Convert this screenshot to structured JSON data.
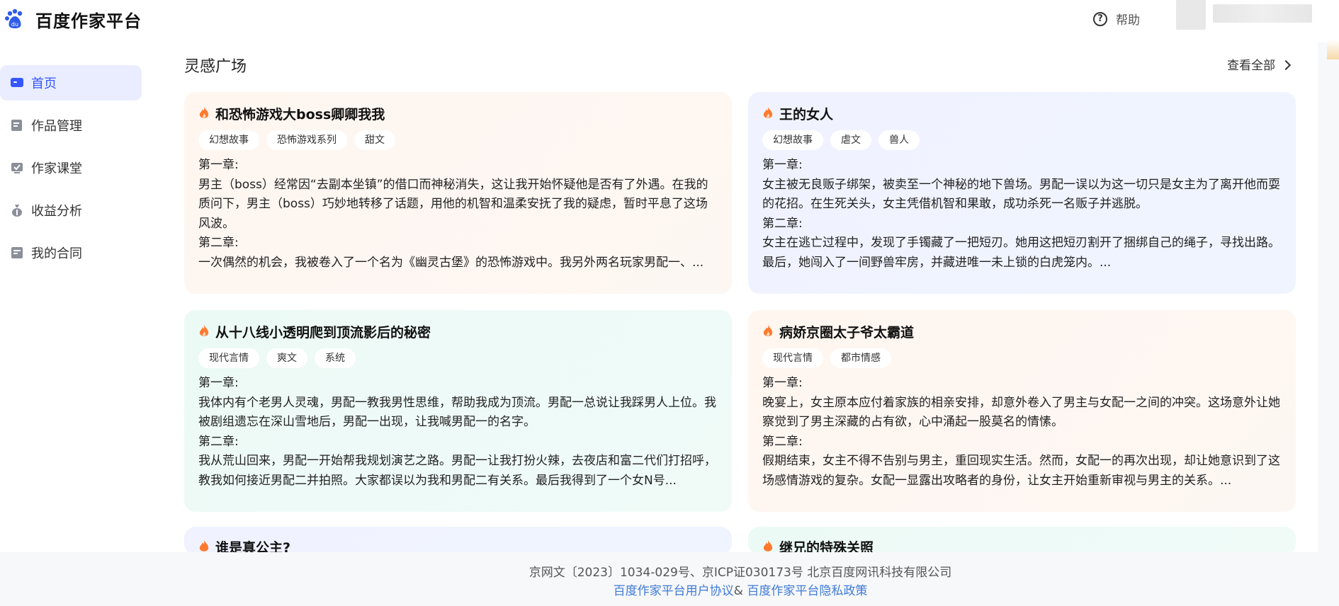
{
  "header": {
    "brand": "百度作家平台",
    "help_label": "帮助",
    "help_icon": "question-circle-icon"
  },
  "sidebar": {
    "items": [
      {
        "label": "首页",
        "icon": "home-icon",
        "active": true
      },
      {
        "label": "作品管理",
        "icon": "book-icon"
      },
      {
        "label": "作家课堂",
        "icon": "classroom-icon"
      },
      {
        "label": "收益分析",
        "icon": "money-bag-icon"
      },
      {
        "label": "我的合同",
        "icon": "contract-icon"
      }
    ]
  },
  "main": {
    "section_title": "灵感广场",
    "view_all": "查看全部",
    "cards": [
      {
        "title": "和恐怖游戏大boss卿卿我我",
        "tags": [
          "幻想故事",
          "恐怖游戏系列",
          "甜文"
        ],
        "ch1_label": "第一章:",
        "ch1_text": "男主（boss）经常因“去副本坐镇”的借口而神秘消失，这让我开始怀疑他是否有了外遇。在我的质问下，男主（boss）巧妙地转移了话题，用他的机智和温柔安抚了我的疑虑，暂时平息了这场风波。",
        "ch2_label": "第二章:",
        "ch2_text": "一次偶然的机会，我被卷入了一个名为《幽灵古堡》的恐怖游戏中。我另外两名玩家男配一、..."
      },
      {
        "title": "王的女人",
        "tags": [
          "幻想故事",
          "虐文",
          "兽人"
        ],
        "ch1_label": "第一章:",
        "ch1_text": "女主被无良贩子绑架，被卖至一个神秘的地下兽场。男配一误以为这一切只是女主为了离开他而耍的花招。在生死关头，女主凭借机智和果敢，成功杀死一名贩子并逃脱。",
        "ch2_label": "第二章:",
        "ch2_text": "女主在逃亡过程中，发现了手镯藏了一把短刃。她用这把短刃割开了捆绑自己的绳子，寻找出路。最后，她闯入了一间野兽牢房，并藏进唯一未上锁的白虎笼内。..."
      },
      {
        "title": "从十八线小透明爬到顶流影后的秘密",
        "tags": [
          "现代言情",
          "爽文",
          "系统"
        ],
        "ch1_label": "第一章:",
        "ch1_text": "我体内有个老男人灵魂，男配一教我男性思维，帮助我成为顶流。男配一总说让我踩男人上位。我被剧组遗忘在深山雪地后，男配一出现，让我喊男配一的名字。",
        "ch2_label": "第二章:",
        "ch2_text": "我从荒山回来，男配一开始帮我规划演艺之路。男配一让我打扮火辣，去夜店和富二代们打招呼，教我如何接近男配二并拍照。大家都误以为我和男配二有关系。最后我得到了一个女N号..."
      },
      {
        "title": "病娇京圈太子爷太霸道",
        "tags": [
          "现代言情",
          "都市情感"
        ],
        "ch1_label": "第一章:",
        "ch1_text": "晚宴上，女主原本应付着家族的相亲安排，却意外卷入了男主与女配一之间的冲突。这场意外让她察觉到了男主深藏的占有欲，心中涌起一股莫名的情愫。",
        "ch2_label": "第二章:",
        "ch2_text": "假期结束，女主不得不告别与男主，重回现实生活。然而，女配一的再次出现，却让她意识到了这场感情游戏的复杂。女配一显露出攻略者的身份，让女主开始重新审视与男主的关系。..."
      },
      {
        "title": "谁是真公主?"
      },
      {
        "title": "继兄的特殊关照"
      }
    ]
  },
  "footer": {
    "line1": "京网文〔2023〕1034-029号、京ICP证030173号 北京百度网讯科技有限公司",
    "agreement": "百度作家平台用户协议",
    "amp": "& ",
    "privacy": "百度作家平台隐私政策"
  },
  "colors": {
    "accent": "#3656ff",
    "active_bg": "#e9edff",
    "fire": "#ff7a2f",
    "link": "#3f7ad6"
  }
}
